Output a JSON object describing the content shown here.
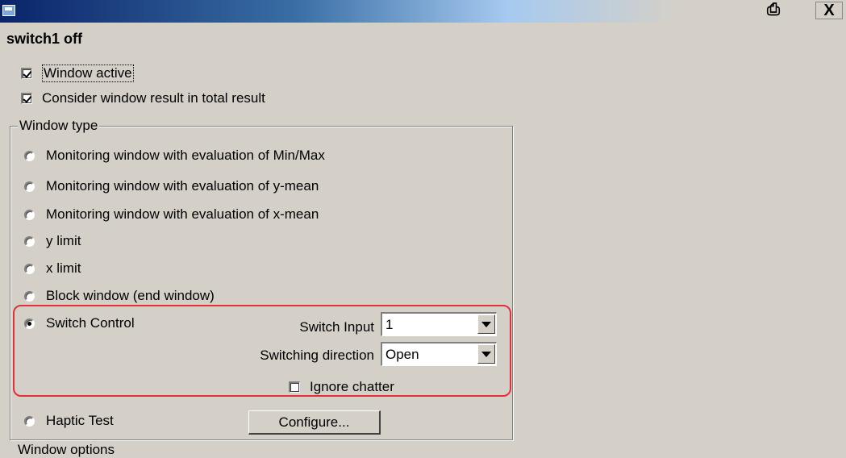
{
  "titlebar": {
    "title": "",
    "print_icon": "print-icon",
    "close_label": "X"
  },
  "heading": "switch1 off",
  "checkboxes": {
    "window_active": {
      "label": "Window active",
      "checked": true
    },
    "consider_result": {
      "label": "Consider window result in total result",
      "checked": true
    }
  },
  "window_type": {
    "legend": "Window type",
    "options": [
      "Monitoring window with evaluation of  Min/Max",
      "Monitoring window with evaluation of y-mean",
      "Monitoring window with evaluation of x-mean",
      "y limit",
      "x limit",
      "Block window (end window)",
      "Switch Control",
      "Haptic Test"
    ],
    "selected": "Switch Control"
  },
  "switch_control": {
    "switch_input_label": "Switch Input",
    "switch_input_value": "1",
    "direction_label": "Switching direction",
    "direction_value": "Open",
    "ignore_chatter_label": "Ignore chatter",
    "ignore_chatter_checked": false
  },
  "haptic": {
    "configure_label": "Configure..."
  },
  "footer": {
    "next_section_partial": "Window options"
  },
  "colors": {
    "highlight": "#e0303a",
    "titlebar": "#0a246a",
    "background": "#d4d0c8"
  }
}
